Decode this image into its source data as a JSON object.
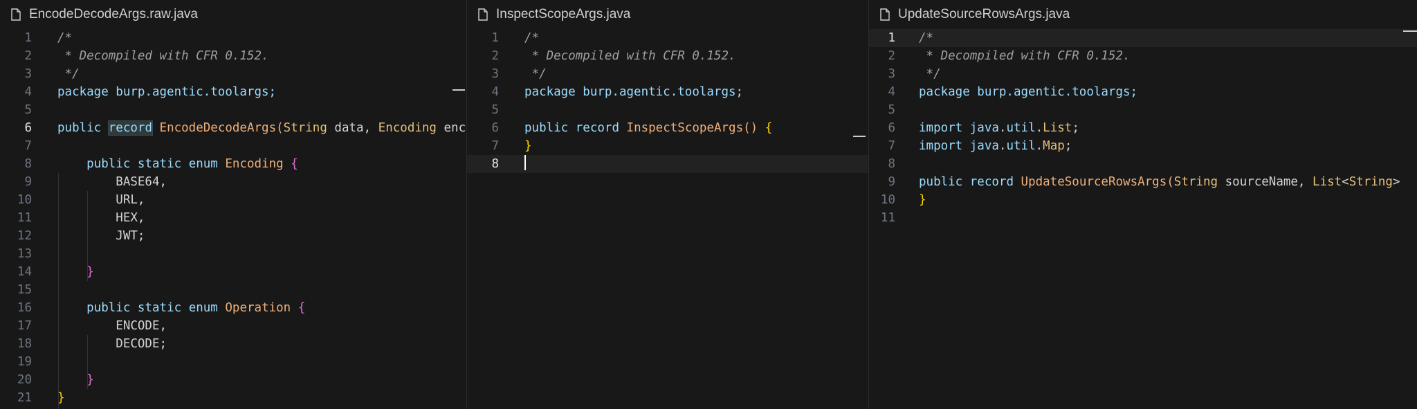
{
  "panes": [
    {
      "tab_title": "EncodeDecodeArgs.raw.java",
      "tab_icon": "file-icon",
      "lines": [
        {
          "n": "1",
          "t": "/*"
        },
        {
          "n": "2",
          "t": " * Decompiled with CFR 0.152."
        },
        {
          "n": "3",
          "t": " */"
        },
        {
          "n": "4",
          "t": "package burp.agentic.toolargs;"
        },
        {
          "n": "5",
          "t": ""
        },
        {
          "n": "6",
          "t": "public record EncodeDecodeArgs(String data, Encoding enco"
        },
        {
          "n": "7",
          "t": ""
        },
        {
          "n": "8",
          "t": "    public static enum Encoding {"
        },
        {
          "n": "9",
          "t": "        BASE64,"
        },
        {
          "n": "10",
          "t": "        URL,"
        },
        {
          "n": "11",
          "t": "        HEX,"
        },
        {
          "n": "12",
          "t": "        JWT;"
        },
        {
          "n": "13",
          "t": ""
        },
        {
          "n": "14",
          "t": "    }"
        },
        {
          "n": "15",
          "t": ""
        },
        {
          "n": "16",
          "t": "    public static enum Operation {"
        },
        {
          "n": "17",
          "t": "        ENCODE,"
        },
        {
          "n": "18",
          "t": "        DECODE;"
        },
        {
          "n": "19",
          "t": ""
        },
        {
          "n": "20",
          "t": "    }"
        },
        {
          "n": "21",
          "t": "}"
        }
      ]
    },
    {
      "tab_title": "InspectScopeArgs.java",
      "tab_icon": "file-icon",
      "lines": [
        {
          "n": "1",
          "t": "/*"
        },
        {
          "n": "2",
          "t": " * Decompiled with CFR 0.152."
        },
        {
          "n": "3",
          "t": " */"
        },
        {
          "n": "4",
          "t": "package burp.agentic.toolargs;"
        },
        {
          "n": "5",
          "t": ""
        },
        {
          "n": "6",
          "t": "public record InspectScopeArgs() {"
        },
        {
          "n": "7",
          "t": "}"
        },
        {
          "n": "8",
          "t": ""
        }
      ]
    },
    {
      "tab_title": "UpdateSourceRowsArgs.java",
      "tab_icon": "file-icon",
      "lines": [
        {
          "n": "1",
          "t": "/*"
        },
        {
          "n": "2",
          "t": " * Decompiled with CFR 0.152."
        },
        {
          "n": "3",
          "t": " */"
        },
        {
          "n": "4",
          "t": "package burp.agentic.toolargs;"
        },
        {
          "n": "5",
          "t": ""
        },
        {
          "n": "6",
          "t": "import java.util.List;"
        },
        {
          "n": "7",
          "t": "import java.util.Map;"
        },
        {
          "n": "8",
          "t": ""
        },
        {
          "n": "9",
          "t": "public record UpdateSourceRowsArgs(String sourceName, List<String>"
        },
        {
          "n": "10",
          "t": "}"
        },
        {
          "n": "11",
          "t": ""
        }
      ]
    }
  ],
  "colors": {
    "background": "#181818",
    "comment": "#a0a0a0",
    "keyword": "#9cdcfe",
    "type": "#e5c07b",
    "class_name": "#f0b07a",
    "brace_level1": "#ffd700",
    "brace_level2": "#da70d6",
    "line_number": "#6e7681"
  }
}
